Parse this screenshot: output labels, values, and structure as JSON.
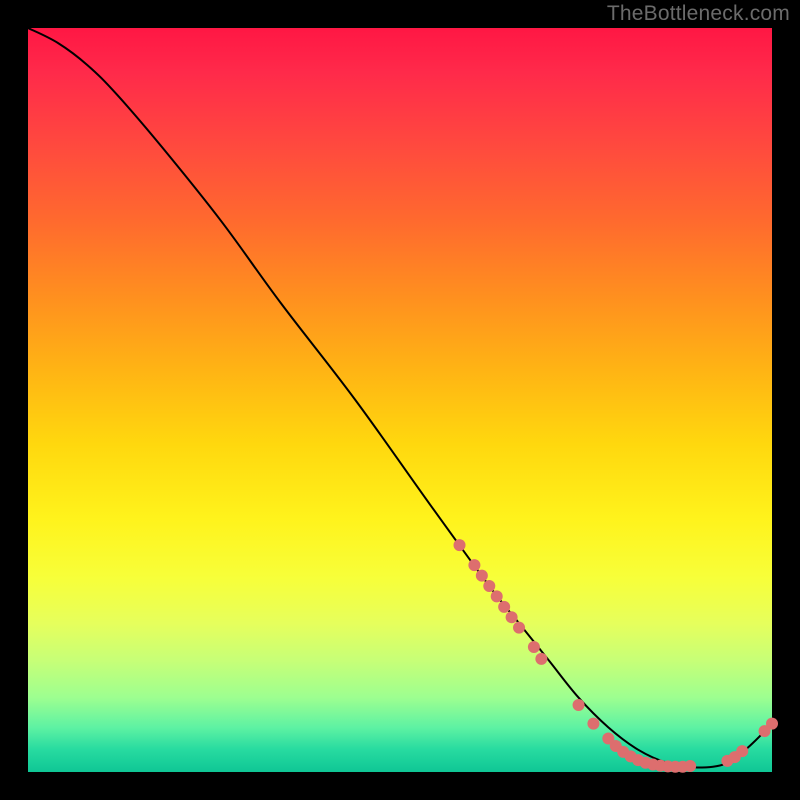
{
  "watermark": "TheBottleneck.com",
  "colors": {
    "frame_bg": "#000000",
    "marker": "#dd6e6e",
    "curve": "#000000",
    "gradient_top": "#ff1744",
    "gradient_mid": "#ffe81c",
    "gradient_bottom": "#0fc695"
  },
  "chart_data": {
    "type": "line",
    "title": "",
    "xlabel": "",
    "ylabel": "",
    "xlim": [
      0,
      100
    ],
    "ylim": [
      0,
      100
    ],
    "grid": false,
    "series": [
      {
        "name": "curve",
        "x": [
          0,
          4,
          8,
          12,
          18,
          26,
          34,
          44,
          54,
          62,
          66,
          70,
          74,
          78,
          82,
          86,
          90,
          94,
          97,
          100
        ],
        "y": [
          100,
          98,
          95,
          91,
          84,
          74,
          63,
          50,
          36,
          25,
          20,
          15,
          10,
          6,
          3,
          1.2,
          0.6,
          1.2,
          3.5,
          6.5
        ]
      }
    ],
    "markers": [
      {
        "name": "cluster-descent",
        "points": [
          {
            "x": 58,
            "y": 30.5
          },
          {
            "x": 60,
            "y": 27.8
          },
          {
            "x": 61,
            "y": 26.4
          },
          {
            "x": 62,
            "y": 25.0
          },
          {
            "x": 63,
            "y": 23.6
          },
          {
            "x": 64,
            "y": 22.2
          },
          {
            "x": 65,
            "y": 20.8
          },
          {
            "x": 66,
            "y": 19.4
          },
          {
            "x": 68,
            "y": 16.8
          },
          {
            "x": 69,
            "y": 15.2
          }
        ]
      },
      {
        "name": "cluster-valley",
        "points": [
          {
            "x": 74,
            "y": 9.0
          },
          {
            "x": 76,
            "y": 6.5
          },
          {
            "x": 78,
            "y": 4.5
          },
          {
            "x": 79,
            "y": 3.5
          },
          {
            "x": 80,
            "y": 2.7
          },
          {
            "x": 81,
            "y": 2.1
          },
          {
            "x": 82,
            "y": 1.6
          },
          {
            "x": 83,
            "y": 1.25
          },
          {
            "x": 84,
            "y": 1.0
          },
          {
            "x": 85,
            "y": 0.85
          },
          {
            "x": 86,
            "y": 0.75
          },
          {
            "x": 87,
            "y": 0.7
          },
          {
            "x": 88,
            "y": 0.7
          },
          {
            "x": 89,
            "y": 0.8
          }
        ]
      },
      {
        "name": "cluster-rise",
        "points": [
          {
            "x": 94,
            "y": 1.5
          },
          {
            "x": 95,
            "y": 2.0
          },
          {
            "x": 96,
            "y": 2.8
          },
          {
            "x": 99,
            "y": 5.5
          },
          {
            "x": 100,
            "y": 6.5
          }
        ]
      }
    ]
  }
}
